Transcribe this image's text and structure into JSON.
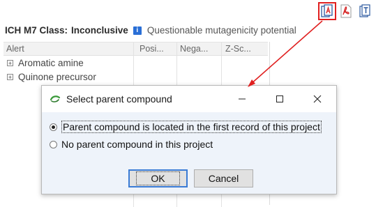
{
  "toolbar": {
    "buttons": [
      {
        "icon": "report-export-icon",
        "active": true
      },
      {
        "icon": "pdf-icon",
        "active": false
      },
      {
        "icon": "text-document-icon",
        "active": false
      }
    ]
  },
  "classification": {
    "label": "ICH M7 Class:",
    "value": "Inconclusive",
    "info_badge": "i",
    "description": "Questionable mutagenicity potential"
  },
  "grid": {
    "columns": [
      "Alert",
      "Posi...",
      "Nega...",
      "Z-Sc..."
    ],
    "rows": [
      {
        "expander": "+",
        "label": "Aromatic amine"
      },
      {
        "expander": "+",
        "label": "Quinone precursor"
      }
    ]
  },
  "dialog": {
    "title": "Select parent compound",
    "minimize_glyph": "—",
    "close_glyph": "✕",
    "options": [
      {
        "label": "Parent compound is located in the first record of this project",
        "selected": true
      },
      {
        "label": "No parent compound in this project",
        "selected": false
      }
    ],
    "ok_label": "OK",
    "cancel_label": "Cancel"
  },
  "colors": {
    "annotation_red": "#e02020",
    "dialog_body": "#eef3fa",
    "info_blue": "#2a6fd6",
    "default_button_border": "#3a7bd5"
  }
}
